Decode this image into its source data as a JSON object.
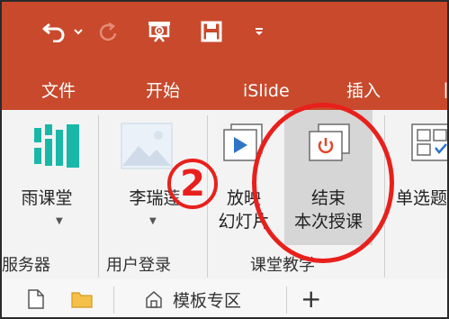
{
  "quick_access": {
    "icons": [
      "undo-icon",
      "dropdown-arrow-icon",
      "redo-icon",
      "present-from-beginning-icon",
      "save-icon",
      "customize-qat-icon"
    ]
  },
  "tabs": [
    {
      "label": "文件"
    },
    {
      "label": "开始"
    },
    {
      "label": "iSlide"
    },
    {
      "label": "插入"
    },
    {
      "label": "丨"
    }
  ],
  "ribbon": {
    "yuketang_label": "雨课堂",
    "login_label": "李瑞莲",
    "play_label_line1": "放映",
    "play_label_line2": "幻灯片",
    "end_label_line1": "结束",
    "end_label_line2": "本次授课",
    "select_label": "单选题",
    "groups": {
      "server": "服务器",
      "user_login": "用户登录",
      "class_teaching": "课堂教学"
    }
  },
  "bottom_bar": {
    "template_area_label": "模板专区",
    "add_label": "+"
  },
  "annotation": {
    "step_number": "2"
  },
  "colors": {
    "title_bar": "#c9492c",
    "accent_red": "#e8201c",
    "ribbon_bg": "#f3f3f3",
    "active_button_bg": "#d6d6d6"
  }
}
